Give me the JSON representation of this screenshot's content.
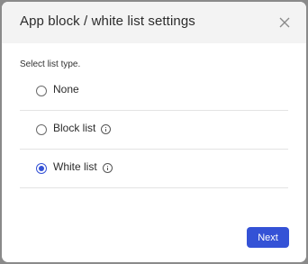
{
  "dialog": {
    "title": "App block / white list settings",
    "prompt": "Select list type.",
    "options": [
      {
        "label": "None",
        "selected": false,
        "has_info": false
      },
      {
        "label": "Block list",
        "selected": false,
        "has_info": true
      },
      {
        "label": "White list",
        "selected": true,
        "has_info": true
      }
    ],
    "next_label": "Next"
  },
  "colors": {
    "accent": "#3452d6",
    "header_bg": "#f3f3f3",
    "backdrop": "#8a8a8a"
  },
  "icons": {
    "close": "close-icon",
    "info": "info-icon"
  }
}
